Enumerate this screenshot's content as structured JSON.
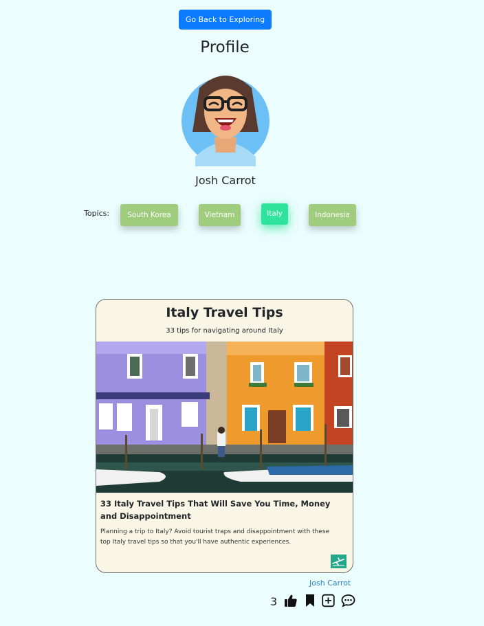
{
  "nav": {
    "back_label": "Go Back to Exploring"
  },
  "page": {
    "title": "Profile"
  },
  "profile": {
    "name": "Josh Carrot"
  },
  "topics": {
    "label": "Topics:",
    "items": [
      "South Korea",
      "Vietnam",
      "Italy",
      "Indonesia"
    ],
    "active": "Italy"
  },
  "card": {
    "title": "Italy Travel Tips",
    "subtitle": "33 tips for navigating around Italy",
    "article_title": "33 Italy Travel Tips That Will Save You Time, Money and Disappointment",
    "article_description": "Planning a trip to Italy? Avoid tourist traps and disappointment with these top Italy travel tips so that you'll have authentic experiences.",
    "source_icon": "plane-icon"
  },
  "footer": {
    "author": "Josh Carrot",
    "like_count": "3",
    "icons": [
      "thumbs-up-icon",
      "bookmark-icon",
      "plus-square-icon",
      "comment-icon"
    ]
  },
  "colors": {
    "background": "#ebfdfd",
    "primary_button": "#0d7bfd",
    "topic": "#a0cd7d",
    "topic_active": "#2ee39c",
    "card_background": "#faf6e6",
    "link": "#2a84c6"
  }
}
